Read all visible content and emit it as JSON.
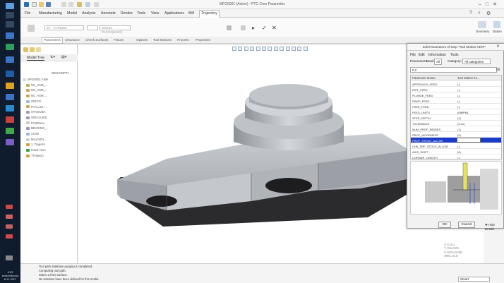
{
  "window": {
    "title": "MFG0001 (Active) - PTC Creo Parametric"
  },
  "menu": [
    {
      "label": "File"
    },
    {
      "label": "Manufacturing"
    },
    {
      "label": "Model"
    },
    {
      "label": "Analysis"
    },
    {
      "label": "Annotate"
    },
    {
      "label": "Render"
    },
    {
      "label": "Tools"
    },
    {
      "label": "View"
    },
    {
      "label": "Applications"
    },
    {
      "label": "Mill"
    },
    {
      "label": "Trajectory"
    }
  ],
  "ribbon": {
    "tool_field": "20 - TA/FB900",
    "fields": [
      "",
      "GRE50 PACO1(51SO)"
    ],
    "right_groups": [
      "Geometry",
      "Datum"
    ],
    "tabs": [
      "Parameters",
      "Clearance",
      "Check Surfaces",
      "Fixture",
      "Options",
      "Tool Motions",
      "Process",
      "Properties"
    ],
    "active_tab": "Parameters"
  },
  "model_tree": {
    "title": "Model Tree",
    "column": "DESCRIPTI...",
    "items": [
      "MFG0001.ASM",
      "NC_ASM_...",
      "NC_ASM_...",
      "NC_ASM_...",
      "ORIGO",
      "PAALAM...",
      "STANA/BA",
      "ORIGO [MI]",
      "FC000xxx",
      "BEARING_...",
      "ACS0",
      "MILL0001...",
      "1. Trajecto",
      "Insert Here",
      "TTrajecto"
    ]
  },
  "dialog": {
    "title": "Edit Parameters of Step \"Tool Motion #1RF\"",
    "menu": [
      "File",
      "Edit",
      "Information",
      "Tools"
    ],
    "parameters_label": "Parameters",
    "tabs": [
      "Basic",
      "All"
    ],
    "active_tab": "All",
    "category_label": "Category:",
    "category_value": "All categories",
    "search_value": "0.2",
    "columns": [
      "Parameter Name",
      "Tool Motion #1..."
    ],
    "rows": [
      {
        "name": "APPROACH_FEED",
        "value": "(-)"
      },
      {
        "name": "EXIT_FEED",
        "value": "(-)"
      },
      {
        "name": "PLUNGE_FEED",
        "value": "(-)"
      },
      {
        "name": "RAMP_FEED",
        "value": "(-)"
      },
      {
        "name": "FREE_FEED",
        "value": "(-)"
      },
      {
        "name": "FEED_UNITS",
        "value": "(MMPM)"
      },
      {
        "name": "STEP_DEPTH",
        "value": "(2)"
      },
      {
        "name": "TOLERANCE",
        "value": "(0.01)"
      },
      {
        "name": "NUM_PROF_PASSES",
        "value": "(1)"
      },
      {
        "name": "PROF_INCREMENT",
        "value": "(0)"
      },
      {
        "name": "PROF_STOCK_ALLOW",
        "value": ""
      },
      {
        "name": "CHK_SRF_STOCK_ALLOW",
        "value": "(-)"
      },
      {
        "name": "AXIS_SHIFT",
        "value": "(0)"
      },
      {
        "name": "CORNER_LENGTH",
        "value": "(-)"
      }
    ],
    "selected_row": 10,
    "ok_label": "OK",
    "cancel_label": "Cancel",
    "hide_details_label": "Hide Details"
  },
  "coord_readout": [
    "X X=0.1",
    "Y XX=0.01",
    "X XXX=0.001",
    "ANG.=0.5"
  ],
  "status": {
    "messages": [
      "Tool path database purging is completed.",
      "Computing tool path.",
      "Select a front surface.",
      "No relations have been defined for this model."
    ],
    "filter_value": "Smart"
  },
  "taskbar": {
    "time": "8.29",
    "day": "keskiviikkona",
    "date": "8.11.2017"
  },
  "colors": {
    "selection": "#1a3cc8",
    "part_top": "#b8bcc2",
    "part_dark": "#2b2b2d",
    "taskbar": "#0f1c2e"
  }
}
